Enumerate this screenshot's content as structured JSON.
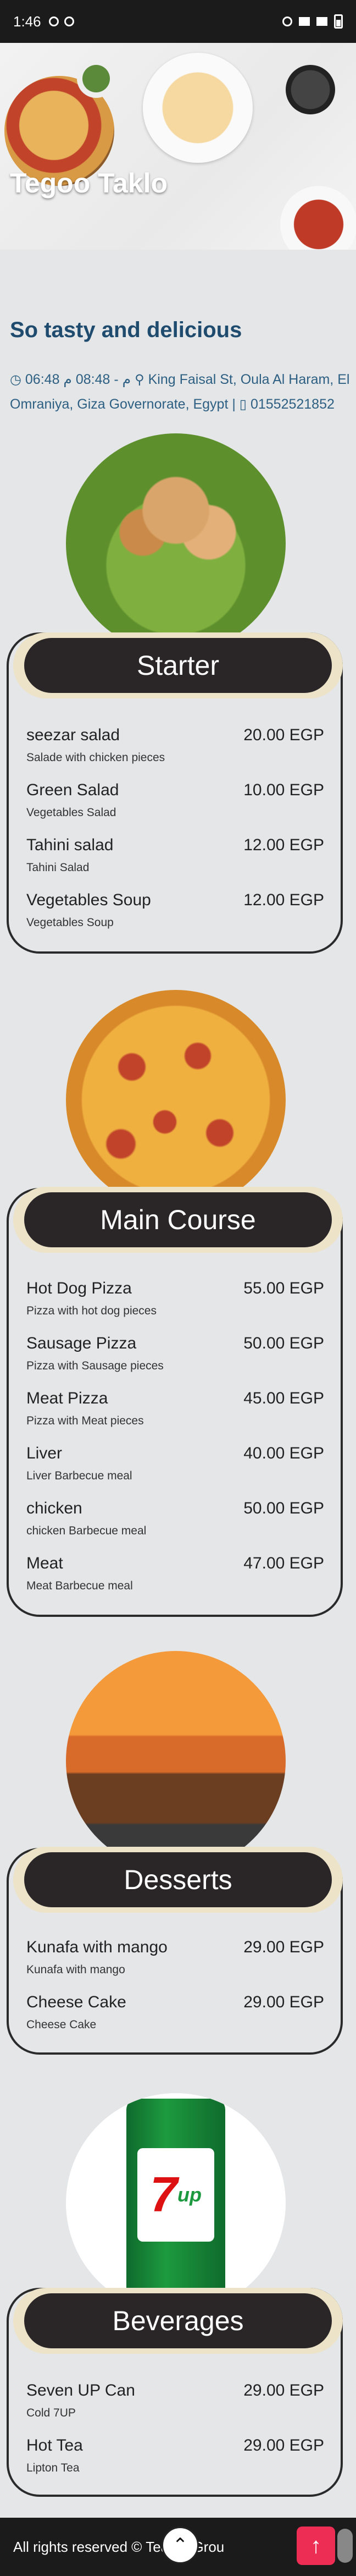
{
  "status_bar": {
    "time": "1:46"
  },
  "hero": {
    "title": "Tegoo Taklo"
  },
  "intro": {
    "tagline": "So tasty and delicious",
    "hours": "06:48 م - 08:48 م",
    "address": "King Faisal St, Oula Al Haram, El Omraniya, Giza Governorate, Egypt |",
    "phone": "01552521852"
  },
  "sections": [
    {
      "title": "Starter",
      "items": [
        {
          "name": "seezar salad",
          "price": "20.00 EGP",
          "desc": "Salade with chicken pieces"
        },
        {
          "name": "Green Salad",
          "price": "10.00 EGP",
          "desc": "Vegetables Salad"
        },
        {
          "name": "Tahini salad",
          "price": "12.00 EGP",
          "desc": "Tahini Salad"
        },
        {
          "name": "Vegetables Soup",
          "price": "12.00 EGP",
          "desc": "Vegetables Soup"
        }
      ]
    },
    {
      "title": "Main Course",
      "items": [
        {
          "name": "Hot Dog Pizza",
          "price": "55.00 EGP",
          "desc": "Pizza with hot dog pieces"
        },
        {
          "name": "Sausage Pizza",
          "price": "50.00 EGP",
          "desc": "Pizza with Sausage pieces"
        },
        {
          "name": "Meat Pizza",
          "price": "45.00 EGP",
          "desc": "Pizza with Meat pieces"
        },
        {
          "name": "Liver",
          "price": "40.00 EGP",
          "desc": "Liver Barbecue meal"
        },
        {
          "name": "chicken",
          "price": "50.00 EGP",
          "desc": "chicken Barbecue meal"
        },
        {
          "name": "Meat",
          "price": "47.00 EGP",
          "desc": "Meat Barbecue meal"
        }
      ]
    },
    {
      "title": "Desserts",
      "items": [
        {
          "name": "Kunafa with mango",
          "price": "29.00 EGP",
          "desc": "Kunafa with mango"
        },
        {
          "name": "Cheese Cake",
          "price": "29.00 EGP",
          "desc": "Cheese Cake"
        }
      ]
    },
    {
      "title": "Beverages",
      "items": [
        {
          "name": "Seven UP Can",
          "price": "29.00 EGP",
          "desc": "Cold 7UP"
        },
        {
          "name": "Hot Tea",
          "price": "29.00 EGP",
          "desc": "Lipton Tea"
        }
      ]
    }
  ],
  "beverage_logo": {
    "main": "7",
    "sub": "up"
  },
  "footer": {
    "text": "All rights reserved © Team I Grou"
  },
  "icons": {
    "clock": "clock-icon",
    "location": "map-marker-icon",
    "phone": "phone-icon",
    "scroll_top": "arrow-up-icon",
    "fab": "arrow-up-icon"
  }
}
